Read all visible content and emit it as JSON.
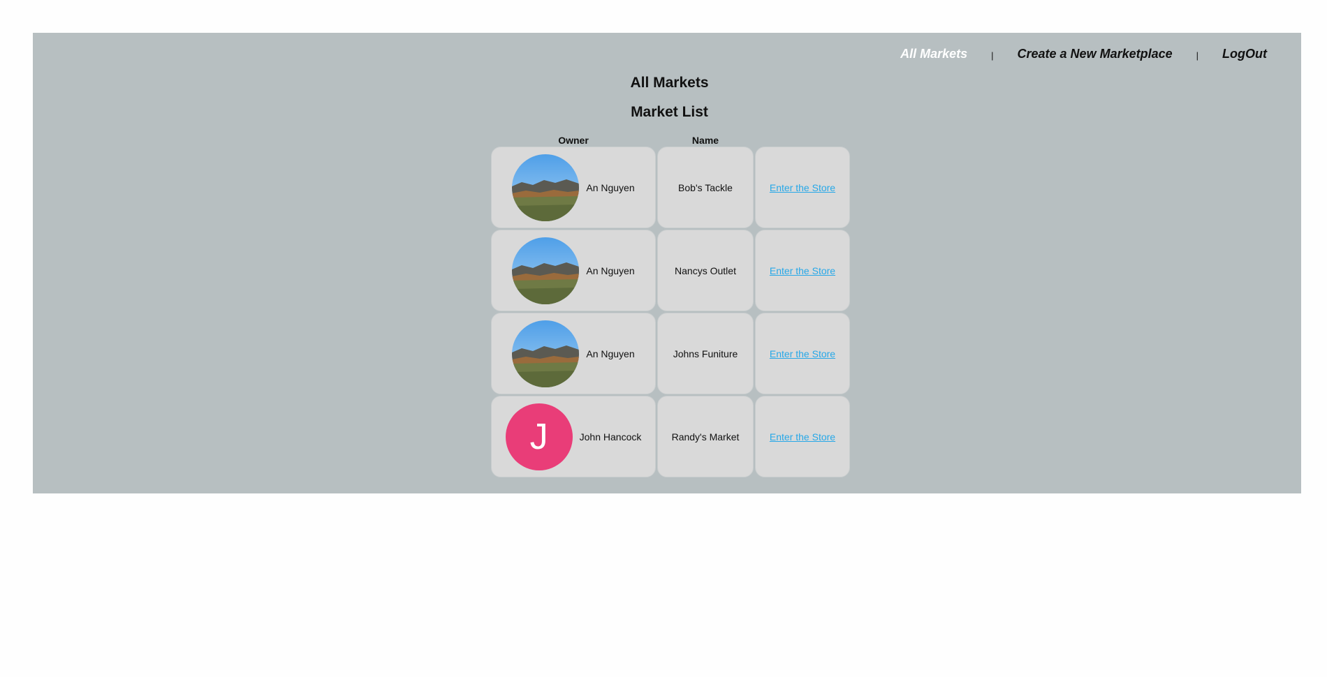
{
  "nav": {
    "items": [
      {
        "label": "All Markets",
        "active": true
      },
      {
        "label": "Create a New Marketplace",
        "active": false
      },
      {
        "label": "LogOut",
        "active": false
      }
    ],
    "separator": "|"
  },
  "page": {
    "title": "All Markets",
    "subtitle": "Market List"
  },
  "table": {
    "headers": [
      "Owner",
      "Name",
      ""
    ],
    "rows": [
      {
        "avatar": "landscape-photo",
        "owner": "An Nguyen",
        "name": "Bob's Tackle",
        "link": "Enter the Store"
      },
      {
        "avatar": "landscape-photo",
        "owner": "An Nguyen",
        "name": "Nancys Outlet",
        "link": "Enter the Store"
      },
      {
        "avatar": "landscape-photo",
        "owner": "An Nguyen",
        "name": "Johns Funiture",
        "link": "Enter the Store"
      },
      {
        "avatar": "letter",
        "avatar_letter": "J",
        "avatar_color": "#e93d78",
        "owner": "John Hancock",
        "name": "Randy's Market",
        "link": "Enter the Store"
      }
    ]
  },
  "colors": {
    "panel": "#b7bfc1",
    "cell": "#d9d9d9",
    "link": "#27a8e8",
    "nav_active": "#ffffff"
  }
}
